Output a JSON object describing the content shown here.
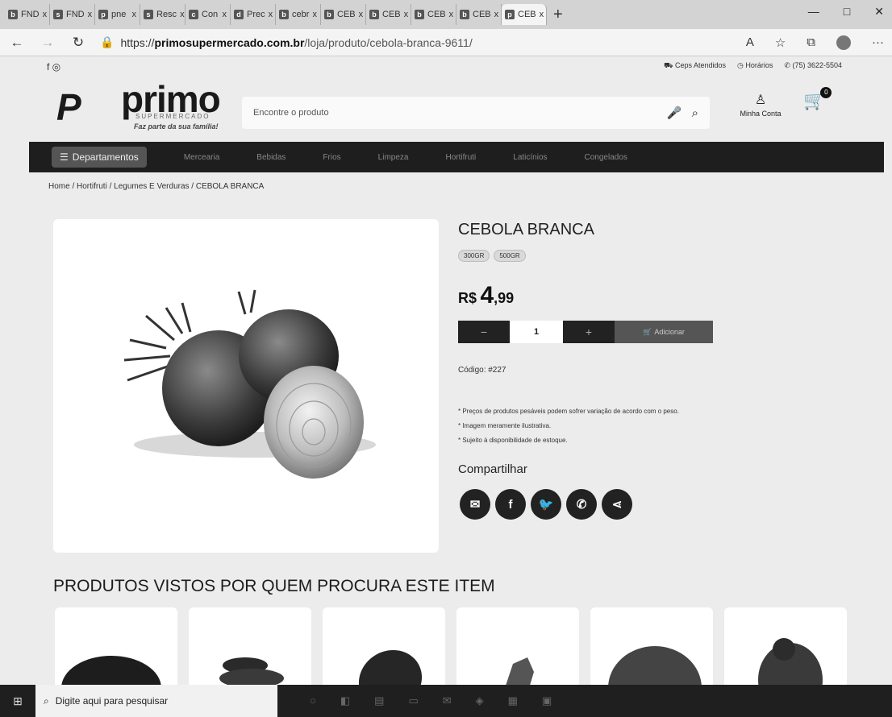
{
  "browser": {
    "tabs": [
      {
        "label": "FND",
        "icon": "b"
      },
      {
        "label": "FND",
        "icon": "s"
      },
      {
        "label": "pne",
        "icon": "p"
      },
      {
        "label": "Resc",
        "icon": "s"
      },
      {
        "label": "Con",
        "icon": "c"
      },
      {
        "label": "Prec",
        "icon": "d"
      },
      {
        "label": "cebr",
        "icon": "b"
      },
      {
        "label": "CEB",
        "icon": "b"
      },
      {
        "label": "CEB",
        "icon": "b"
      },
      {
        "label": "CEB",
        "icon": "b"
      },
      {
        "label": "CEB",
        "icon": "b"
      },
      {
        "label": "CEB",
        "icon": "p"
      }
    ],
    "tab_close": "x",
    "new_tab": "+",
    "url_scheme": "https://",
    "url_host": "primosupermercado.com.br",
    "url_path": "/loja/produto/cebola-branca-9611/"
  },
  "site": {
    "social": "f ◎",
    "top_links": [
      "Ceps Atendidos",
      "Horários",
      "(75) 3622-5504"
    ],
    "logo": {
      "name": "primo",
      "sub": "SUPERMERCADO",
      "slogan": "Faz parte da sua família!"
    },
    "search_placeholder": "Encontre o produto",
    "account_label": "Minha Conta",
    "cart_count": "0",
    "departments_label": "Departamentos",
    "menu": [
      "Mercearia",
      "Bebidas",
      "Frios",
      "Limpeza",
      "Hortifruti",
      "Laticínios",
      "Congelados"
    ]
  },
  "breadcrumb": "Home / Hortifruti / Legumes E Verduras / CEBOLA BRANCA",
  "product": {
    "title": "CEBOLA BRANCA",
    "variants": [
      "300GR",
      "500GR"
    ],
    "price_currency": "R$",
    "price_int": "4",
    "price_cents": ",99",
    "quantity": "1",
    "minus": "−",
    "plus": "+",
    "add_label": "Adicionar",
    "code": "Código: #227",
    "notes": [
      "* Preços de produtos pesáveis podem sofrer variação de acordo com o peso.",
      "* Imagem meramente ilustrativa.",
      "* Sujeito à disponibilidade de estoque."
    ],
    "share_title": "Compartilhar"
  },
  "related_title": "PRODUTOS VISTOS POR QUEM PROCURA ESTE ITEM",
  "taskbar": {
    "search_placeholder": "Digite aqui para pesquisar"
  }
}
